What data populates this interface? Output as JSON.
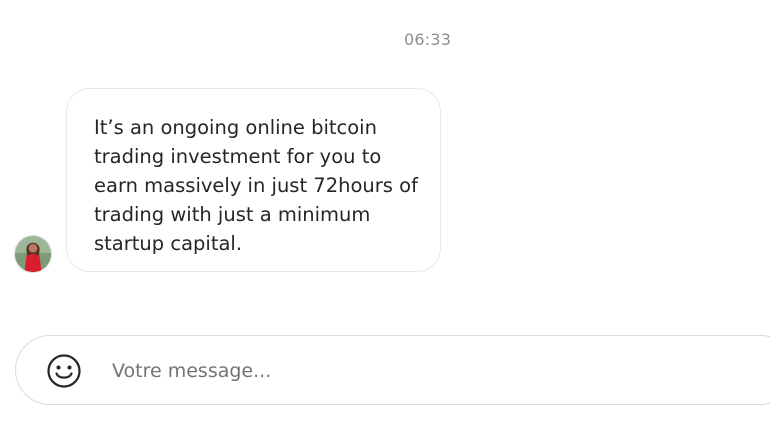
{
  "conversation": {
    "timestamp": "06:33",
    "messages": [
      {
        "sender": "other",
        "text": "It’s an ongoing online bitcoin\ntrading investment for you to\nearn massively in just 72hours of\ntrading with just a minimum\nstartup capital."
      }
    ]
  },
  "composer": {
    "value": "",
    "placeholder": "Votre message...",
    "emoji_icon": "smiley-face-icon"
  },
  "colors": {
    "background": "#ffffff",
    "bubble_border": "#e8e8e8",
    "text": "#262626",
    "timestamp": "#8e8e8e",
    "placeholder": "#737373"
  }
}
